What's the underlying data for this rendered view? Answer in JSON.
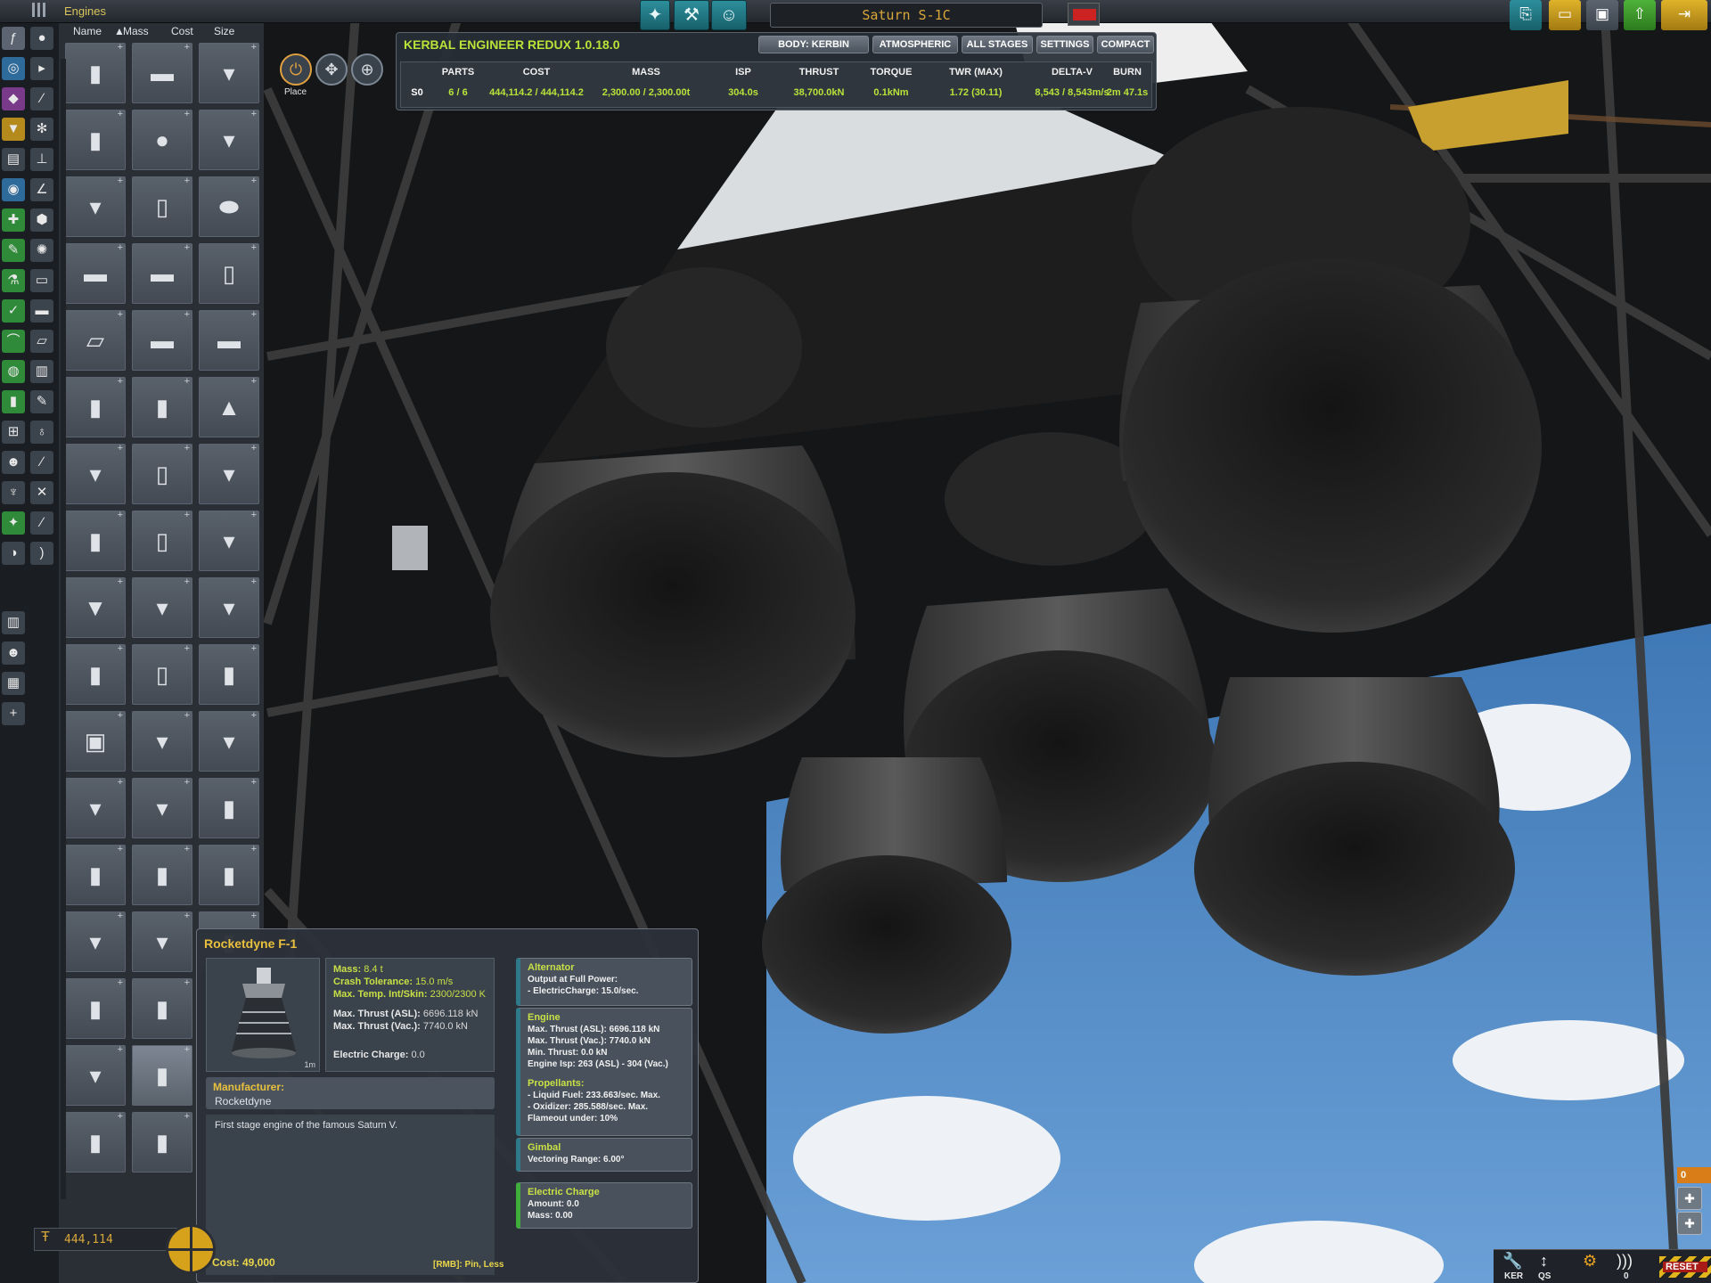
{
  "topbar": {
    "category_title": "Engines",
    "ship_name": "Saturn S-1C"
  },
  "parts_panel": {
    "sort_headers": [
      "Name",
      "Mass",
      "Cost",
      "Size"
    ],
    "sort_active_arrow": "▲"
  },
  "modes": {
    "place_label": "Place"
  },
  "ker": {
    "title": "KERBAL ENGINEER REDUX 1.0.18.0",
    "buttons": [
      "BODY: KERBIN",
      "ATMOSPHERIC",
      "ALL STAGES",
      "SETTINGS",
      "COMPACT"
    ],
    "headers": [
      "PARTS",
      "COST",
      "MASS",
      "ISP",
      "THRUST",
      "TORQUE",
      "TWR (MAX)",
      "DELTA-V",
      "BURN"
    ],
    "row": {
      "stage": "S0",
      "values": [
        "6 / 6",
        "444,114.2 / 444,114.2",
        "2,300.00 / 2,300.00t",
        "304.0s",
        "38,700.0kN",
        "0.1kNm",
        "1.72 (30.11)",
        "8,543 / 8,543m/s",
        "2m 47.1s"
      ]
    }
  },
  "part_info": {
    "name": "Rocketdyne F-1",
    "size": "1m",
    "stats": [
      {
        "label": "Mass:",
        "value": "8.4 t"
      },
      {
        "label": "Crash Tolerance:",
        "value": "15.0 m/s"
      },
      {
        "label": "Max. Temp. Int/Skin:",
        "value": "2300/2300 K"
      },
      {
        "label": "Max. Thrust (ASL):",
        "value": "6696.118 kN"
      },
      {
        "label": "Max. Thrust (Vac.):",
        "value": "7740.0 kN"
      },
      {
        "label": "Electric Charge:",
        "value": "0.0"
      }
    ],
    "manufacturer_label": "Manufacturer:",
    "manufacturer": "Rocketdyne",
    "description": "First stage engine of the famous Saturn V.",
    "modules": {
      "alternator": {
        "title": "Alternator",
        "lines": [
          "Output at Full Power:",
          "- ElectricCharge: 15.0/sec."
        ]
      },
      "engine": {
        "title": "Engine",
        "lines": [
          "Max. Thrust (ASL): 6696.118 kN",
          "Max. Thrust (Vac.): 7740.0 kN",
          "Min. Thrust: 0.0 kN",
          "Engine Isp: 263 (ASL) - 304 (Vac.)"
        ],
        "prop_title": "Propellants:",
        "prop_lines": [
          "- Liquid Fuel: 233.663/sec. Max.",
          "- Oxidizer: 285.588/sec. Max.",
          "Flameout under: 10%"
        ]
      },
      "gimbal": {
        "title": "Gimbal",
        "lines": [
          "Vectoring Range: 6.00°"
        ]
      },
      "electric": {
        "title": "Electric Charge",
        "lines": [
          "Amount: 0.0",
          "Mass: 0.00"
        ]
      }
    }
  },
  "bottom": {
    "funds": "444,114",
    "cost": "Cost: 49,000",
    "rmb_hint": "[RMB]: Pin, Less",
    "stage_count": "0",
    "ker_label": "KER",
    "qs_label": "QS",
    "comm_count": "0",
    "reset_label": "RESET"
  },
  "colors": {
    "accent_green": "#b8e43a",
    "accent_gold": "#e9c03d",
    "teal_button": "#2d8f9c"
  }
}
